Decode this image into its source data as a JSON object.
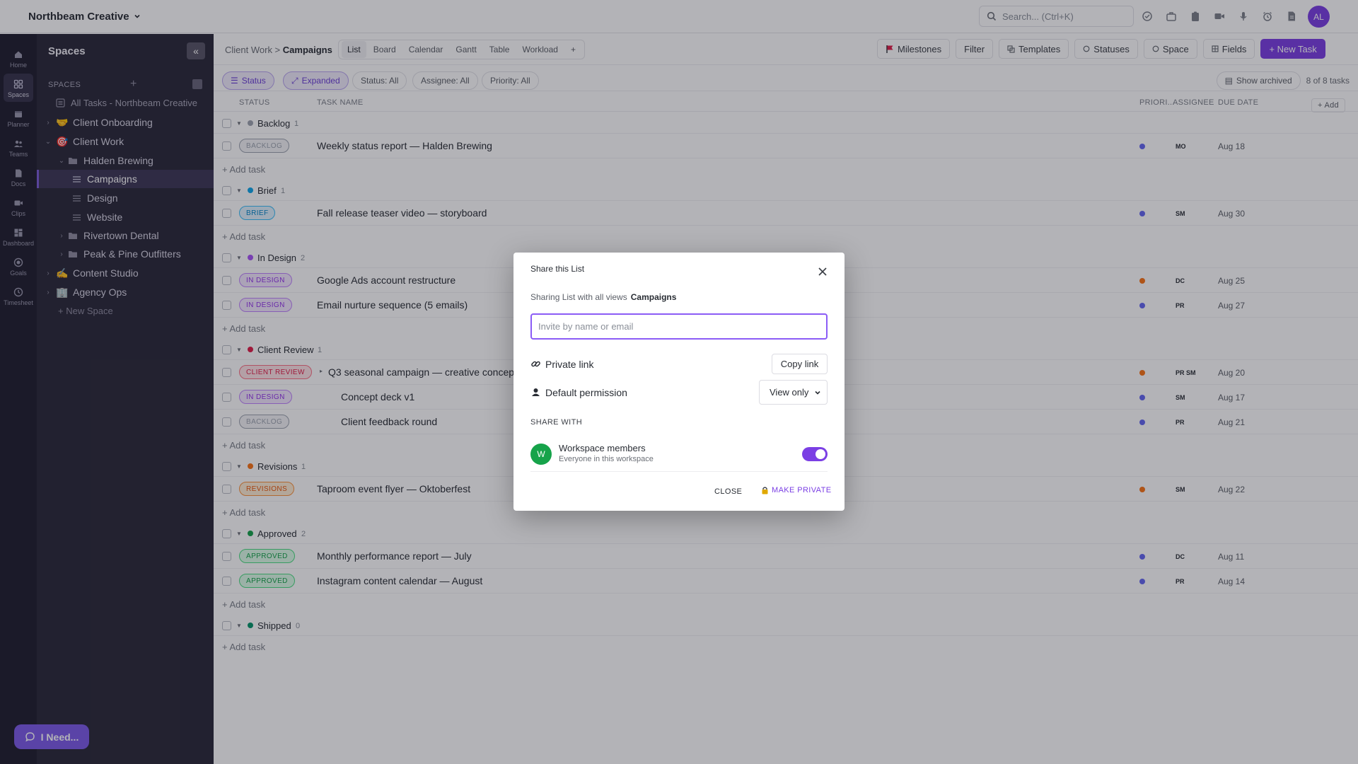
{
  "topbar": {
    "workspace": "Northbeam Creative",
    "search_placeholder": "Search... (Ctrl+K)",
    "avatar": "AL",
    "icons": [
      "check-circle-icon",
      "briefcase-icon",
      "clipboard-icon",
      "video-icon",
      "microphone-icon",
      "alarm-clock-icon",
      "document-icon"
    ]
  },
  "rail": {
    "items": [
      {
        "label": "Home",
        "icon": "home-icon"
      },
      {
        "label": "Spaces",
        "icon": "grid-icon"
      },
      {
        "label": "Planner",
        "icon": "calendar-icon"
      },
      {
        "label": "Teams",
        "icon": "people-icon"
      },
      {
        "label": "Docs",
        "icon": "doc-icon"
      },
      {
        "label": "Clips",
        "icon": "video-icon"
      },
      {
        "label": "Dashboard",
        "icon": "dashboard-icon"
      },
      {
        "label": "Goals",
        "icon": "target-icon"
      },
      {
        "label": "Timesheet",
        "icon": "clock-icon"
      }
    ]
  },
  "sidebar": {
    "title": "Spaces",
    "section_label": "SPACES",
    "all_tasks": "All Tasks - Northbeam Creative",
    "tree": [
      {
        "label": "Client Onboarding",
        "emoji": "🤝"
      },
      {
        "label": "Client Work",
        "emoji": "🎯"
      },
      {
        "label": "Halden Brewing"
      },
      {
        "label": "Campaigns"
      },
      {
        "label": "Design"
      },
      {
        "label": "Website"
      },
      {
        "label": "Rivertown Dental"
      },
      {
        "label": "Peak & Pine Outfitters"
      },
      {
        "label": "Content Studio",
        "emoji": "✍"
      },
      {
        "label": "Agency Ops",
        "emoji": "🏢"
      }
    ],
    "new_space": "+ New Space"
  },
  "ineed": "I Need...",
  "viewbar": {
    "crumb_parent": "Client Work >",
    "crumb_current": "Campaigns",
    "tabs": [
      "List",
      "Board",
      "Calendar",
      "Gantt",
      "Table",
      "Workload",
      "+"
    ],
    "buttons": {
      "milestones": "Milestones",
      "filter": "Filter",
      "templates": "Templates",
      "statuses": "Statuses",
      "space": "Space",
      "fields": "Fields",
      "new_task": "+ New Task"
    }
  },
  "filterbar": {
    "status": "Status",
    "expanded": "Expanded",
    "status_all": "Status: All",
    "assignee_all": "Assignee: All",
    "priority_all": "Priority: All",
    "show_archived": "Show archived",
    "count": "8 of 8 tasks"
  },
  "columns": {
    "status": "STATUS",
    "name": "TASK NAME",
    "priority": "PRIORI...",
    "assignee": "ASSIGNEE",
    "due": "DUE DATE",
    "add": "+ Add"
  },
  "add_task_label": "+ Add task",
  "groups": [
    {
      "name": "Backlog",
      "count": "1",
      "color": "#9ca3af",
      "tasks": [
        {
          "status": "BACKLOG",
          "name": "Weekly status report — Halden Brewing",
          "priority_color": "#6366f1",
          "assignee": "MO",
          "due": "Aug 18"
        }
      ]
    },
    {
      "name": "Brief",
      "count": "1",
      "color": "#0ea5e9",
      "tasks": [
        {
          "status": "BRIEF",
          "name": "Fall release teaser video — storyboard",
          "priority_color": "#6366f1",
          "assignee": "SM",
          "due": "Aug 30"
        }
      ]
    },
    {
      "name": "In Design",
      "count": "2",
      "color": "#a855f7",
      "tasks": [
        {
          "status": "IN DESIGN",
          "name": "Google Ads account restructure",
          "priority_color": "#f97316",
          "assignee": "DC",
          "due": "Aug 25"
        },
        {
          "status": "IN DESIGN",
          "name": "Email nurture sequence (5 emails)",
          "priority_color": "#6366f1",
          "assignee": "PR",
          "due": "Aug 27"
        }
      ]
    },
    {
      "name": "Client Review",
      "count": "1",
      "color": "#e11d48",
      "tasks": [
        {
          "status": "CLIENT REVIEW",
          "name": "Q3 seasonal campaign — creative concepts",
          "priority_color": "#f97316",
          "assignee": "PR SM",
          "due": "Aug 20"
        },
        {
          "status": "IN DESIGN",
          "name": "Concept deck v1",
          "priority_color": "#6366f1",
          "assignee": "SM",
          "due": "Aug 17"
        },
        {
          "status": "BACKLOG",
          "name": "Client feedback round",
          "priority_color": "#6366f1",
          "assignee": "PR",
          "due": "Aug 21"
        }
      ]
    },
    {
      "name": "Revisions",
      "count": "1",
      "color": "#f97316",
      "tasks": [
        {
          "status": "REVISIONS",
          "name": "Taproom event flyer — Oktoberfest",
          "priority_color": "#f97316",
          "assignee": "SM",
          "due": "Aug 22"
        }
      ]
    },
    {
      "name": "Approved",
      "count": "2",
      "color": "#16a34a",
      "tasks": [
        {
          "status": "APPROVED",
          "name": "Monthly performance report — July",
          "priority_color": "#6366f1",
          "assignee": "DC",
          "due": "Aug 11"
        },
        {
          "status": "APPROVED",
          "name": "Instagram content calendar — August",
          "priority_color": "#6366f1",
          "assignee": "PR",
          "due": "Aug 14"
        }
      ]
    },
    {
      "name": "Shipped",
      "count": "0",
      "color": "#059669",
      "tasks": []
    }
  ],
  "modal": {
    "title": "Share this List",
    "subtitle": "Sharing List with all views",
    "list_name": "Campaigns",
    "invite_placeholder": "Invite by name or email",
    "private_link": "Private link",
    "copy_link": "Copy link",
    "default_permission": "Default permission",
    "permission_value": "View only",
    "share_with": "SHARE WITH",
    "member_avatar": "W",
    "member_name": "Workspace members",
    "member_desc": "Everyone in this workspace",
    "toggle_on": true,
    "close": "CLOSE",
    "make_private": "MAKE PRIVATE"
  }
}
